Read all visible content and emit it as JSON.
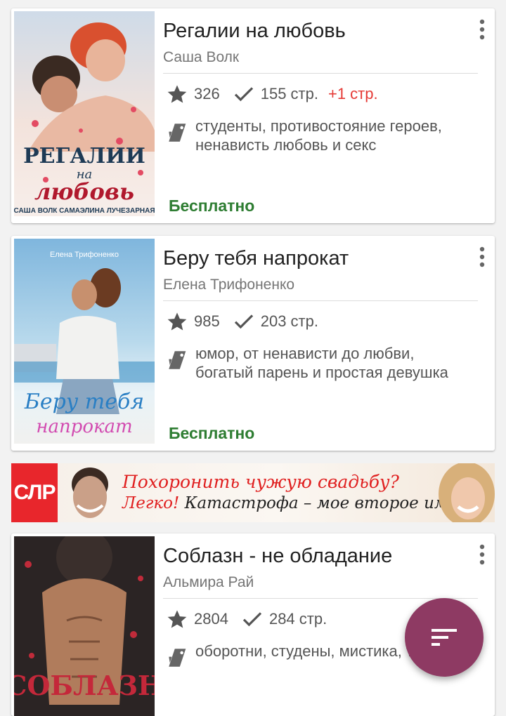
{
  "books": [
    {
      "title": "Регалии на любовь",
      "author": "Саша Волк",
      "rating": "326",
      "pages": "155 стр.",
      "new_pages": "+1 стр.",
      "tags_line1": "студенты, противостояние героев,",
      "tags_line2": "ненависть любовь и секс",
      "price": "Бесплатно",
      "cover": {
        "line1": "РЕГАЛИИ",
        "line2": "на",
        "line3": "любовь",
        "authors": "САША ВОЛК САМАЭЛИНА ЛУЧЕЗАРНАЯ"
      }
    },
    {
      "title": "Беру тебя напрокат",
      "author": "Елена Трифоненко",
      "rating": "985",
      "pages": "203 стр.",
      "tags_line1": "юмор, от ненависти до любви,",
      "tags_line2": "богатый парень и простая девушка",
      "price": "Бесплатно",
      "cover": {
        "author": "Елена Трифоненко",
        "line1": "Беру тебя",
        "line2": "напрокат"
      }
    },
    {
      "title": "Соблазн - не обладание",
      "author": "Альмира Рай",
      "rating": "2804",
      "pages": "284 стр.",
      "tags_line1": "оборотни, студены, мистика, тайны",
      "cover": {
        "line1": "СОБЛАЗН"
      }
    }
  ],
  "ad": {
    "logo": "СЛР",
    "line1": "Похоронить чужую свадьбу?",
    "line2a": "Легко!",
    "line2b": " Катастрофа – мое второе имя"
  },
  "colors": {
    "price_green": "#2e7d32",
    "new_pages_red": "#e53935",
    "fab_purple": "#8e3a63"
  },
  "icons": {
    "rating": "star-icon",
    "pages": "check-icon",
    "tags": "tag-icon",
    "menu": "more-vert-icon",
    "fab": "filter-sort-icon"
  }
}
